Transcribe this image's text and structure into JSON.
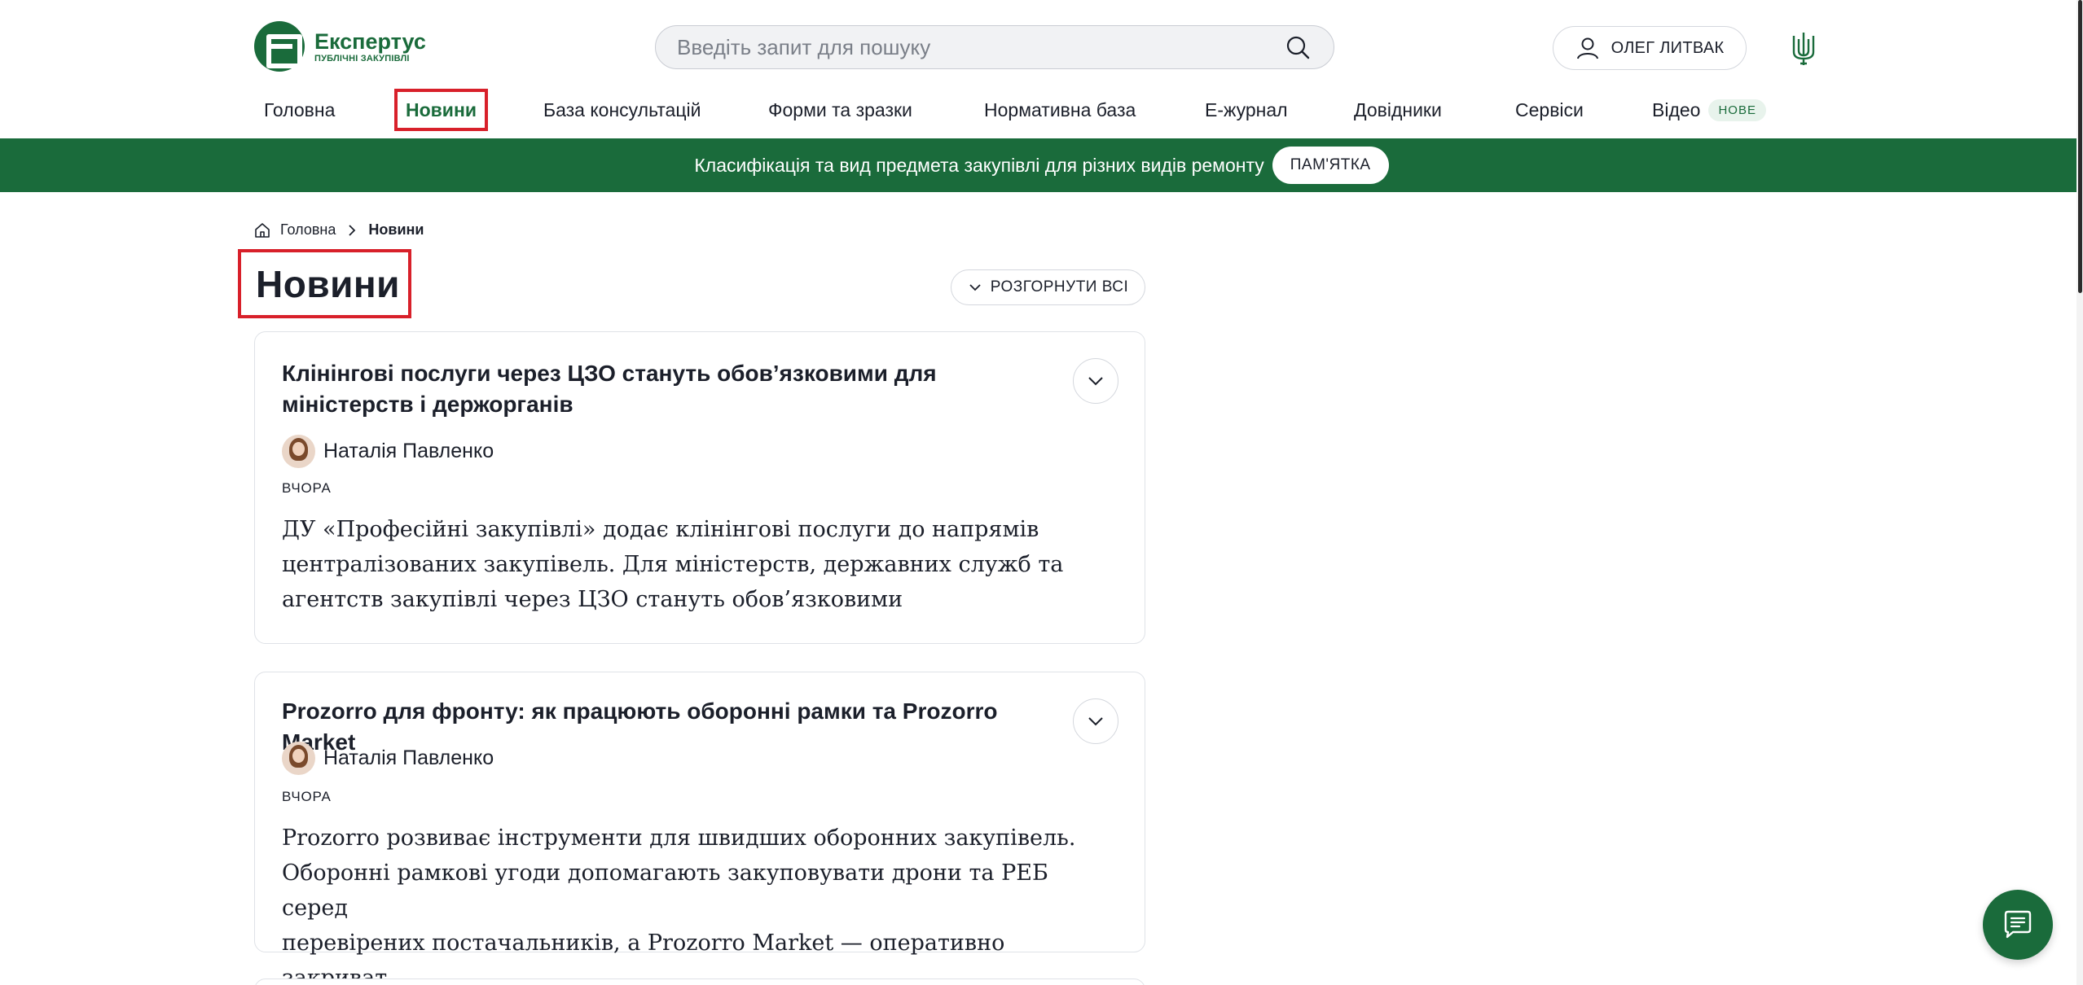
{
  "logo": {
    "title": "Експертус",
    "subtitle": "ПУБЛІЧНІ ЗАКУПІВЛІ"
  },
  "search": {
    "placeholder": "Введіть запит для пошуку",
    "value": ""
  },
  "user": {
    "name": "ОЛЕГ ЛИТВАК"
  },
  "nav": {
    "items": [
      {
        "label": "Головна"
      },
      {
        "label": "Новини",
        "active": true
      },
      {
        "label": "База консультацій"
      },
      {
        "label": "Форми та зразки"
      },
      {
        "label": "Нормативна база"
      },
      {
        "label": "Е-журнал"
      },
      {
        "label": "Довідники"
      },
      {
        "label": "Сервіси"
      },
      {
        "label": "Відео",
        "badge": "НОВЕ"
      }
    ]
  },
  "banner": {
    "text": "Класифікація та вид предмета закупівлі для різних видів ремонту",
    "button": "ПАМ'ЯТКА"
  },
  "breadcrumb": {
    "home": "Головна",
    "current": "Новини"
  },
  "page": {
    "title": "Новини",
    "expand_all": "РОЗГОРНУТИ ВСІ"
  },
  "articles": [
    {
      "title": "Клінінгові послуги через ЦЗО стануть обов’язковими для міністерств і держорганів",
      "author": "Наталія Павленко",
      "date": "ВЧОРА",
      "excerpt_lines": [
        "ДУ «Професійні закупівлі» додає клінінгові послуги до напрямів",
        "централізованих закупівель. Для міністерств, державних служб та",
        "агентств закупівлі через ЦЗО стануть обов’язковими"
      ]
    },
    {
      "title": "Prozorro для фронту: як працюють оборонні рамки та Prozorro Market",
      "author": "Наталія Павленко",
      "date": "ВЧОРА",
      "excerpt_lines": [
        "Prozorro розвиває інструменти для швидших оборонних закупівель.",
        "Оборонні рамкові угоди допомагають закуповувати дрони та РЕБ серед",
        "перевірених постачальників, а Prozorro Market — оперативно закриват…"
      ]
    }
  ],
  "colors": {
    "brand": "#1a6b3b",
    "highlight": "#d8202a"
  }
}
